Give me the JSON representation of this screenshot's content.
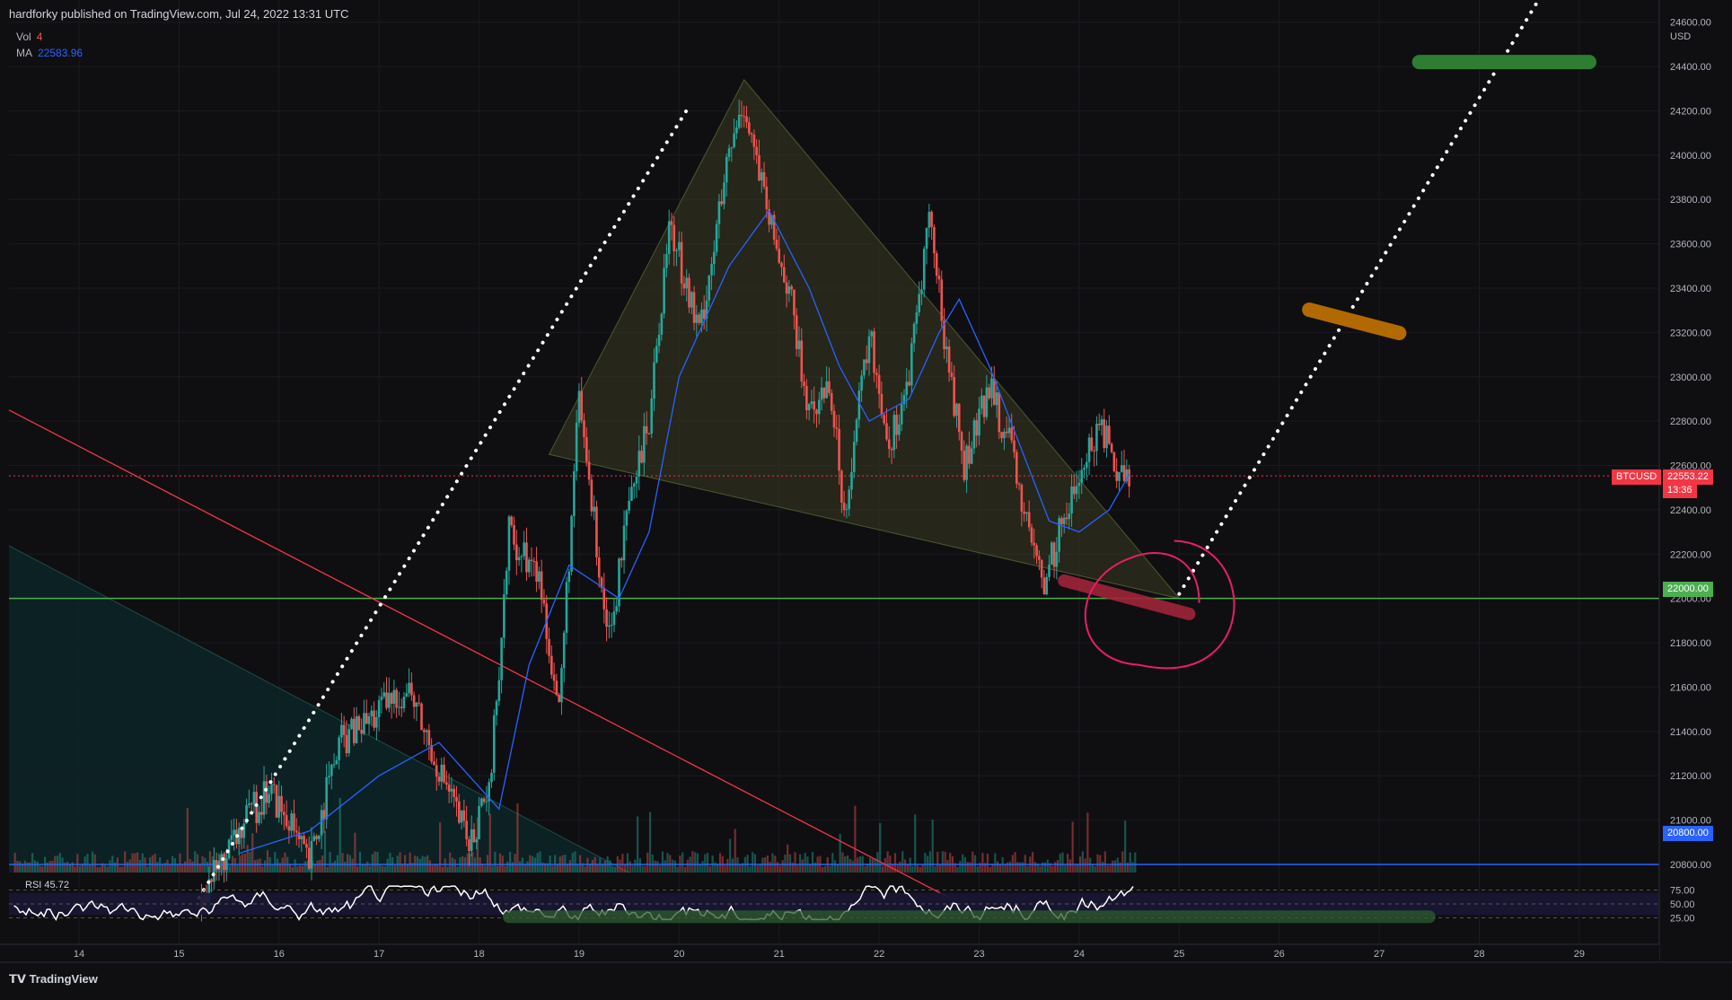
{
  "header": {
    "published_by": "hardforky published on TradingView.com, Jul 24, 2022 13:31 UTC"
  },
  "legend": {
    "vol_label": "Vol",
    "vol_value": "4",
    "ma_label": "MA",
    "ma_value": "22583.96"
  },
  "price_axis": {
    "unit": "USD",
    "ticks": [
      "24600.00",
      "24400.00",
      "24200.00",
      "24000.00",
      "23800.00",
      "23600.00",
      "23400.00",
      "23200.00",
      "23000.00",
      "22800.00",
      "22600.00",
      "22400.00",
      "22200.00",
      "22000.00",
      "21800.00",
      "21600.00",
      "21400.00",
      "21200.00",
      "21000.00",
      "20800.00"
    ]
  },
  "time_axis": {
    "ticks": [
      "14",
      "15",
      "16",
      "17",
      "18",
      "19",
      "20",
      "21",
      "22",
      "23",
      "24",
      "25",
      "26",
      "27",
      "28",
      "29"
    ]
  },
  "price_tags": {
    "symbol": "BTCUSD",
    "last_price": "22553.22",
    "countdown": "13:36",
    "level_green": "22000.00",
    "level_blue": "20800.00"
  },
  "rsi": {
    "label": "RSI",
    "value": "45.72",
    "ticks": [
      "75.00",
      "50.00",
      "25.00"
    ]
  },
  "footer": {
    "brand": "TradingView"
  },
  "colors": {
    "background": "#0f0f12",
    "up": "#26a69a",
    "down": "#ef5350",
    "ma": "#2962ff",
    "green_level": "#4caf50",
    "blue_level": "#2962ff",
    "red_trend": "#f23645",
    "triangle_fill": "#3a3a20",
    "pink_circle": "#e91e63",
    "target_green": "#2e7d32",
    "target_orange": "#b26a00"
  },
  "chart_data": {
    "type": "candlestick",
    "symbol": "BTCUSD",
    "ylim": [
      20650,
      24700
    ],
    "x_range": [
      "13.3",
      "29.8"
    ],
    "key_levels": [
      22000,
      20800
    ],
    "last_price": 22553.22,
    "price_path": [
      {
        "x": 15.2,
        "y": 20650
      },
      {
        "x": 15.6,
        "y": 20950
      },
      {
        "x": 15.9,
        "y": 21150
      },
      {
        "x": 16.3,
        "y": 20800
      },
      {
        "x": 16.6,
        "y": 21350
      },
      {
        "x": 17.3,
        "y": 21600
      },
      {
        "x": 17.5,
        "y": 21350
      },
      {
        "x": 17.9,
        "y": 20900
      },
      {
        "x": 18.1,
        "y": 21100
      },
      {
        "x": 18.3,
        "y": 22300
      },
      {
        "x": 18.6,
        "y": 22100
      },
      {
        "x": 18.8,
        "y": 21500
      },
      {
        "x": 19.0,
        "y": 22900
      },
      {
        "x": 19.3,
        "y": 21800
      },
      {
        "x": 19.5,
        "y": 22400
      },
      {
        "x": 19.7,
        "y": 22800
      },
      {
        "x": 19.9,
        "y": 23700
      },
      {
        "x": 20.2,
        "y": 23200
      },
      {
        "x": 20.5,
        "y": 24000
      },
      {
        "x": 20.65,
        "y": 24250
      },
      {
        "x": 20.9,
        "y": 23700
      },
      {
        "x": 21.1,
        "y": 23400
      },
      {
        "x": 21.3,
        "y": 22800
      },
      {
        "x": 21.5,
        "y": 23000
      },
      {
        "x": 21.65,
        "y": 22400
      },
      {
        "x": 21.9,
        "y": 23200
      },
      {
        "x": 22.1,
        "y": 22700
      },
      {
        "x": 22.3,
        "y": 23000
      },
      {
        "x": 22.5,
        "y": 23750
      },
      {
        "x": 22.65,
        "y": 23200
      },
      {
        "x": 22.85,
        "y": 22600
      },
      {
        "x": 23.1,
        "y": 22950
      },
      {
        "x": 23.3,
        "y": 22700
      },
      {
        "x": 23.5,
        "y": 22300
      },
      {
        "x": 23.65,
        "y": 22050
      },
      {
        "x": 23.8,
        "y": 22300
      },
      {
        "x": 24.0,
        "y": 22550
      },
      {
        "x": 24.2,
        "y": 22800
      },
      {
        "x": 24.35,
        "y": 22600
      },
      {
        "x": 24.5,
        "y": 22553
      }
    ],
    "ma_path": [
      {
        "x": 15.6,
        "y": 20850
      },
      {
        "x": 16.3,
        "y": 20950
      },
      {
        "x": 17.0,
        "y": 21200
      },
      {
        "x": 17.6,
        "y": 21350
      },
      {
        "x": 18.2,
        "y": 21050
      },
      {
        "x": 18.5,
        "y": 21700
      },
      {
        "x": 18.9,
        "y": 22150
      },
      {
        "x": 19.4,
        "y": 22000
      },
      {
        "x": 19.7,
        "y": 22300
      },
      {
        "x": 20.0,
        "y": 23000
      },
      {
        "x": 20.5,
        "y": 23500
      },
      {
        "x": 20.9,
        "y": 23750
      },
      {
        "x": 21.3,
        "y": 23400
      },
      {
        "x": 21.6,
        "y": 23050
      },
      {
        "x": 21.9,
        "y": 22800
      },
      {
        "x": 22.3,
        "y": 22900
      },
      {
        "x": 22.6,
        "y": 23200
      },
      {
        "x": 22.8,
        "y": 23350
      },
      {
        "x": 23.1,
        "y": 23050
      },
      {
        "x": 23.4,
        "y": 22700
      },
      {
        "x": 23.7,
        "y": 22350
      },
      {
        "x": 24.0,
        "y": 22300
      },
      {
        "x": 24.3,
        "y": 22400
      },
      {
        "x": 24.5,
        "y": 22560
      }
    ],
    "projection_lines": [
      {
        "from": {
          "x": 15.2,
          "y": 20650
        },
        "to": {
          "x": 20.1,
          "y": 24220
        }
      },
      {
        "from": {
          "x": 25.0,
          "y": 22020
        },
        "to": {
          "x": 28.7,
          "y": 24780
        }
      }
    ],
    "triangle": [
      {
        "x": 18.7,
        "y": 22650
      },
      {
        "x": 20.65,
        "y": 24340
      },
      {
        "x": 25.0,
        "y": 22000
      }
    ],
    "descending_trendline": {
      "from": {
        "x": 13.3,
        "y": 22850
      },
      "to": {
        "x": 22.7,
        "y": 20650
      }
    },
    "targets": [
      {
        "color": "green",
        "x_from": 27.4,
        "x_to": 29.1,
        "y": 24420
      },
      {
        "color": "orange",
        "x_from": 26.3,
        "x_to": 27.2,
        "y": 23250
      }
    ]
  }
}
